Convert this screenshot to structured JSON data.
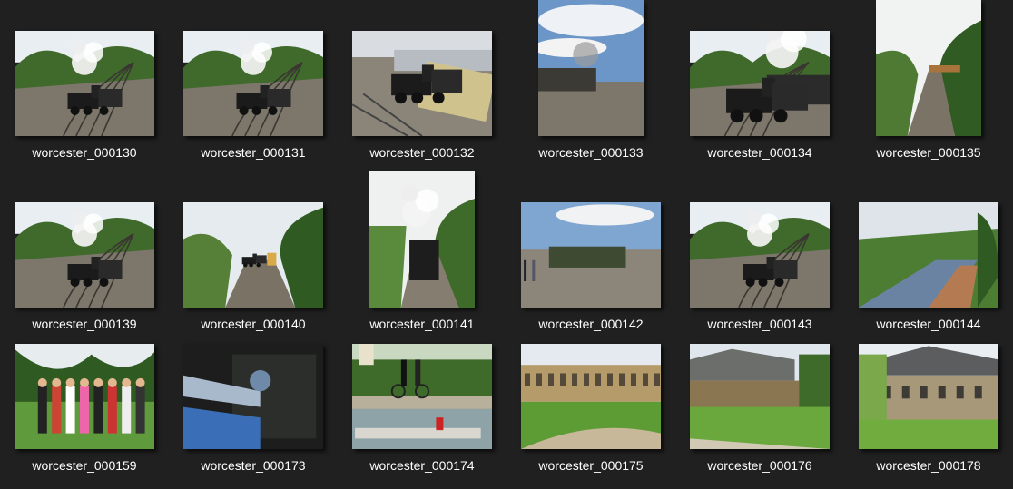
{
  "files": [
    {
      "name": "worcester_000130",
      "scene": "train-curve"
    },
    {
      "name": "worcester_000131",
      "scene": "train-curve"
    },
    {
      "name": "worcester_000132",
      "scene": "train-station-carpark"
    },
    {
      "name": "worcester_000133",
      "scene": "train-sky"
    },
    {
      "name": "worcester_000134",
      "scene": "train-close"
    },
    {
      "name": "worcester_000135",
      "scene": "track-cutting"
    },
    {
      "name": "worcester_000139",
      "scene": "train-curve"
    },
    {
      "name": "worcester_000140",
      "scene": "track-cutting-wide"
    },
    {
      "name": "worcester_000141",
      "scene": "train-front"
    },
    {
      "name": "worcester_000142",
      "scene": "platform"
    },
    {
      "name": "worcester_000143",
      "scene": "train-curve"
    },
    {
      "name": "worcester_000144",
      "scene": "container-train"
    },
    {
      "name": "worcester_000159",
      "scene": "group-lawn"
    },
    {
      "name": "worcester_000173",
      "scene": "dark-detail"
    },
    {
      "name": "worcester_000174",
      "scene": "river-punt"
    },
    {
      "name": "worcester_000175",
      "scene": "college-lawn"
    },
    {
      "name": "worcester_000176",
      "scene": "cottages"
    },
    {
      "name": "worcester_000178",
      "scene": "stone-house"
    }
  ],
  "colors": {
    "background": "#202020",
    "caption": "#ffffff"
  }
}
